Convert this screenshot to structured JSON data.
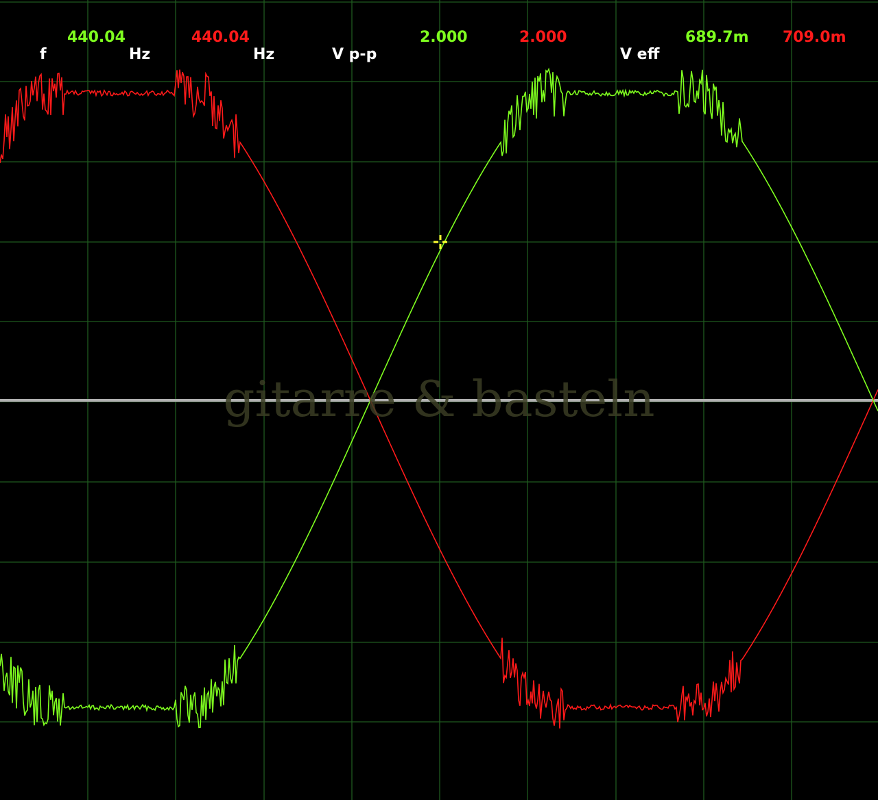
{
  "readout": {
    "freq_label": "f",
    "ch1_freq": "440.04",
    "ch1_freq_unit": "Hz",
    "ch2_freq": "440.04",
    "ch2_freq_unit": "Hz",
    "vpp_label": "V p-p",
    "ch1_vpp": "2.000",
    "ch2_vpp": "2.000",
    "veff_label": "V eff",
    "ch1_veff": "689.7m",
    "ch2_veff": "709.0m"
  },
  "watermark": "gitarre & basteln",
  "colors": {
    "background": "#000000",
    "grid": "#1f5a1f",
    "ch1_trace": "#7fff1f",
    "ch2_trace": "#ff1a1a",
    "zero_line": "#b0b0b0",
    "cursor": "#ffff33"
  },
  "icons": {
    "cursor": "crosshair-cursor-icon"
  }
}
